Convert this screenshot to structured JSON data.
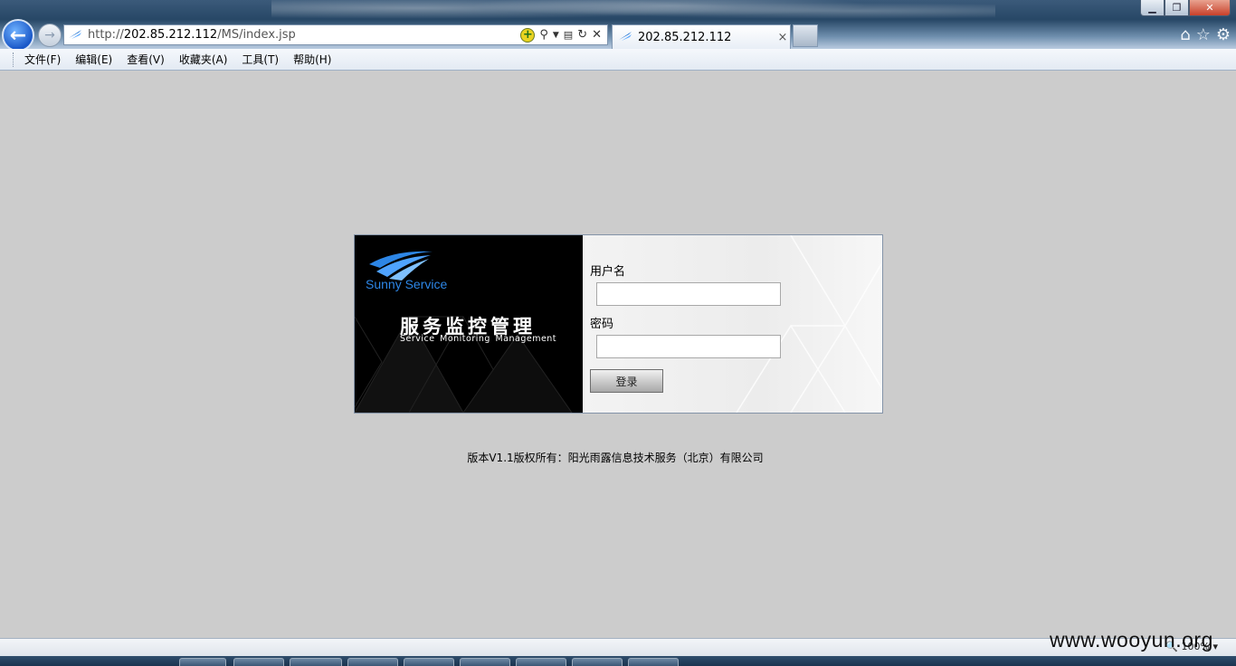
{
  "browser": {
    "address_url_prefix": "http://",
    "address_url_host": "202.85.212.112",
    "address_url_path": "/MS/index.jsp",
    "tab_title": "202.85.212.112",
    "tab_close": "×",
    "menu": [
      "文件(F)",
      "编辑(E)",
      "查看(V)",
      "收藏夹(A)",
      "工具(T)",
      "帮助(H)"
    ],
    "zoom": "100%"
  },
  "login": {
    "brand": "Sunny Service",
    "title_cn": "服务监控管理",
    "title_en": "Service Monitoring Management",
    "username_label": "用户名",
    "username_value": "",
    "password_label": "密码",
    "password_value": "",
    "submit_label": "登录"
  },
  "footer": {
    "copyright": "版本V1.1版权所有：阳光雨露信息技术服务（北京）有限公司"
  },
  "watermark": "www.wooyun.org",
  "icons": {
    "back": "back-arrow-icon",
    "forward": "forward-arrow-icon",
    "home": "home-icon",
    "favorites": "star-icon",
    "settings": "gear-icon"
  },
  "colors": {
    "page_bg": "#cccccc",
    "brand_blue": "#2d86e6",
    "left_panel_bg": "#000000"
  }
}
